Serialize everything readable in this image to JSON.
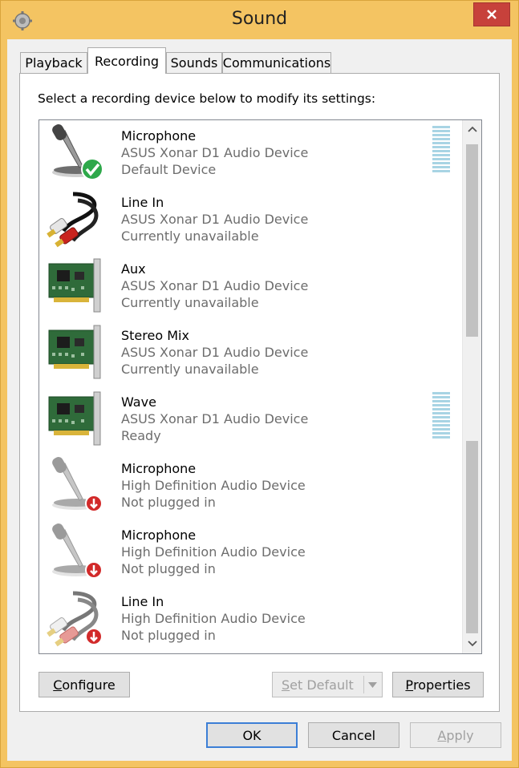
{
  "window": {
    "title": "Sound"
  },
  "tabs": [
    {
      "label": "Playback",
      "active": false
    },
    {
      "label": "Recording",
      "active": true
    },
    {
      "label": "Sounds",
      "active": false
    },
    {
      "label": "Communications",
      "active": false
    }
  ],
  "recording": {
    "instruction": "Select a recording device below to modify its settings:",
    "devices": [
      {
        "name": "Microphone",
        "device": "ASUS Xonar D1 Audio Device",
        "status": "Default Device",
        "icon": "microphone-default-icon"
      },
      {
        "name": "Line In",
        "device": "ASUS Xonar D1 Audio Device",
        "status": "Currently unavailable",
        "icon": "line-in-cable-icon"
      },
      {
        "name": "Aux",
        "device": "ASUS Xonar D1 Audio Device",
        "status": "Currently unavailable",
        "icon": "sound-card-icon"
      },
      {
        "name": "Stereo Mix",
        "device": "ASUS Xonar D1 Audio Device",
        "status": "Currently unavailable",
        "icon": "sound-card-icon"
      },
      {
        "name": "Wave",
        "device": "ASUS Xonar D1 Audio Device",
        "status": "Ready",
        "icon": "sound-card-icon"
      },
      {
        "name": "Microphone",
        "device": "High Definition Audio Device",
        "status": "Not plugged in",
        "icon": "microphone-unplugged-icon"
      },
      {
        "name": "Microphone",
        "device": "High Definition Audio Device",
        "status": "Not plugged in",
        "icon": "microphone-unplugged-icon"
      },
      {
        "name": "Line In",
        "device": "High Definition Audio Device",
        "status": "Not plugged in",
        "icon": "line-in-unplugged-icon"
      }
    ]
  },
  "buttons": {
    "configure": {
      "mnemonic": "C",
      "rest": "onfigure"
    },
    "set_default": {
      "mnemonic": "S",
      "rest": "et Default"
    },
    "properties": {
      "mnemonic": "P",
      "rest": "roperties"
    },
    "ok": "OK",
    "cancel": "Cancel",
    "apply": {
      "mnemonic": "A",
      "rest": "pply"
    }
  },
  "colors": {
    "frame": "#f4c462",
    "close": "#c7413b",
    "accent": "#3c7fd6",
    "meter": "#a8d4e4",
    "check": "#2ea84a",
    "unplugged": "#d22a2a"
  }
}
